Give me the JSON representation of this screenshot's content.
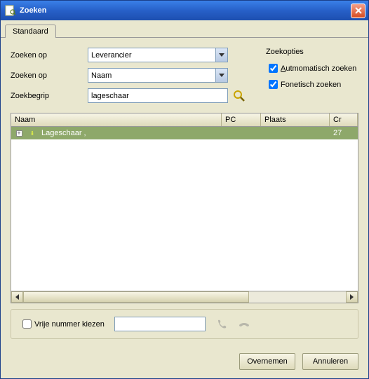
{
  "window": {
    "title": "Zoeken"
  },
  "tabs": {
    "standard": "Standaard"
  },
  "form": {
    "label_zoeken_op": "Zoeken op",
    "label_zoekbegrip": "Zoekbegrip",
    "combo1_value": "Leverancier",
    "combo2_value": "Naam",
    "search_value": "lageschaar",
    "options_heading": "Zoekopties",
    "auto_search_label": "Autmomatisch zoeken",
    "phonetic_label": "Fonetisch zoeken",
    "auto_search_checked": true,
    "phonetic_checked": true
  },
  "grid": {
    "columns": {
      "naam": "Naam",
      "pc": "PC",
      "plaats": "Plaats",
      "cr": "Cr"
    },
    "rows": [
      {
        "naam": "Lageschaar ,",
        "pc": "",
        "plaats": "",
        "cr": "27"
      }
    ]
  },
  "bottom": {
    "free_number_label": "Vrije nummer kiezen",
    "free_number_checked": false,
    "phone_value": ""
  },
  "buttons": {
    "ok": "Overnemen",
    "cancel": "Annuleren"
  }
}
